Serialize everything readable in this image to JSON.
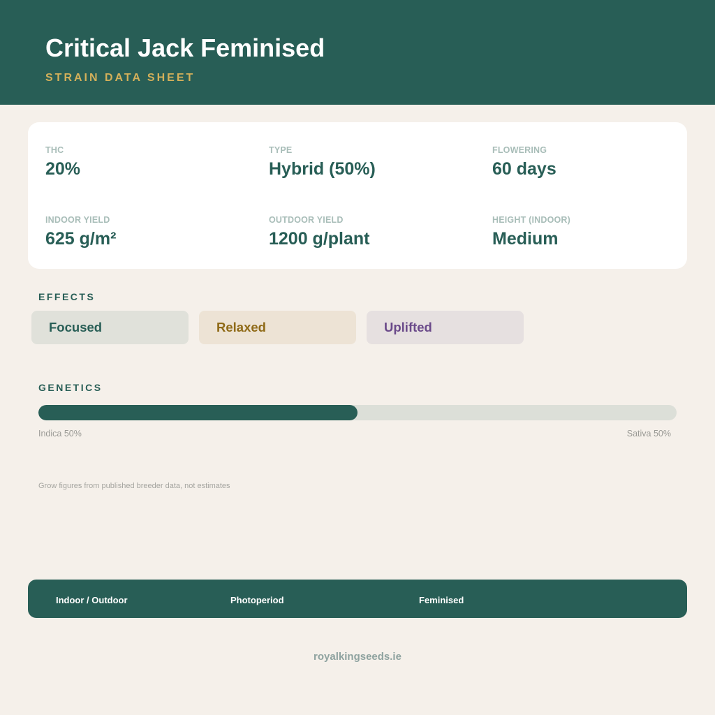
{
  "header": {
    "title": "Critical Jack Feminised",
    "subtitle": "STRAIN DATA SHEET"
  },
  "stats": [
    {
      "label": "THC",
      "value": "20%"
    },
    {
      "label": "TYPE",
      "value": "Hybrid (50%)"
    },
    {
      "label": "FLOWERING",
      "value": "60 days"
    },
    {
      "label": "INDOOR YIELD",
      "value": "625 g/m²"
    },
    {
      "label": "OUTDOOR YIELD",
      "value": "1200 g/plant"
    },
    {
      "label": "HEIGHT (INDOOR)",
      "value": "Medium"
    }
  ],
  "effects": {
    "title": "EFFECTS",
    "items": [
      {
        "label": "Focused",
        "bg": "#e0e1da",
        "color": "#285e56"
      },
      {
        "label": "Relaxed",
        "bg": "#ede3d5",
        "color": "#8f6a17"
      },
      {
        "label": "Uplifted",
        "bg": "#e6e0e0",
        "color": "#6b4a8a"
      }
    ]
  },
  "genetics": {
    "title": "GENETICS",
    "indica_fraction": 0.5,
    "indica_label": "Indica 50%",
    "sativa_label": "Sativa 50%"
  },
  "note": "Grow figures from published breeder data, not estimates",
  "footer": {
    "items": [
      "Indoor / Outdoor",
      "Photoperiod",
      "Feminised"
    ]
  },
  "website": "royalkingseeds.ie",
  "colors": {
    "primary": "#285e56",
    "accent": "#d4b05a",
    "background": "#f5f0ea"
  }
}
